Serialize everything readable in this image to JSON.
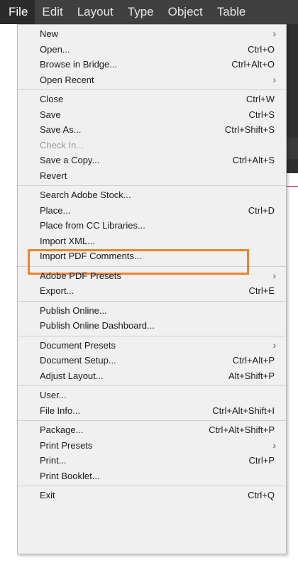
{
  "menubar": {
    "items": [
      "File",
      "Edit",
      "Layout",
      "Type",
      "Object",
      "Table"
    ]
  },
  "file_menu": {
    "groups": [
      [
        {
          "label": "New",
          "shortcut": "",
          "submenu": true,
          "disabled": false
        },
        {
          "label": "Open...",
          "shortcut": "Ctrl+O",
          "submenu": false,
          "disabled": false
        },
        {
          "label": "Browse in Bridge...",
          "shortcut": "Ctrl+Alt+O",
          "submenu": false,
          "disabled": false
        },
        {
          "label": "Open Recent",
          "shortcut": "",
          "submenu": true,
          "disabled": false
        }
      ],
      [
        {
          "label": "Close",
          "shortcut": "Ctrl+W",
          "submenu": false,
          "disabled": false
        },
        {
          "label": "Save",
          "shortcut": "Ctrl+S",
          "submenu": false,
          "disabled": false
        },
        {
          "label": "Save As...",
          "shortcut": "Ctrl+Shift+S",
          "submenu": false,
          "disabled": false
        },
        {
          "label": "Check In...",
          "shortcut": "",
          "submenu": false,
          "disabled": true
        },
        {
          "label": "Save a Copy...",
          "shortcut": "Ctrl+Alt+S",
          "submenu": false,
          "disabled": false
        },
        {
          "label": "Revert",
          "shortcut": "",
          "submenu": false,
          "disabled": false
        }
      ],
      [
        {
          "label": "Search Adobe Stock...",
          "shortcut": "",
          "submenu": false,
          "disabled": false
        },
        {
          "label": "Place...",
          "shortcut": "Ctrl+D",
          "submenu": false,
          "disabled": false,
          "highlighted": true
        },
        {
          "label": "Place from CC Libraries...",
          "shortcut": "",
          "submenu": false,
          "disabled": false
        },
        {
          "label": "Import XML...",
          "shortcut": "",
          "submenu": false,
          "disabled": false
        },
        {
          "label": "Import PDF Comments...",
          "shortcut": "",
          "submenu": false,
          "disabled": false
        }
      ],
      [
        {
          "label": "Adobe PDF Presets",
          "shortcut": "",
          "submenu": true,
          "disabled": false
        },
        {
          "label": "Export...",
          "shortcut": "Ctrl+E",
          "submenu": false,
          "disabled": false
        }
      ],
      [
        {
          "label": "Publish Online...",
          "shortcut": "",
          "submenu": false,
          "disabled": false
        },
        {
          "label": "Publish Online Dashboard...",
          "shortcut": "",
          "submenu": false,
          "disabled": false
        }
      ],
      [
        {
          "label": "Document Presets",
          "shortcut": "",
          "submenu": true,
          "disabled": false
        },
        {
          "label": "Document Setup...",
          "shortcut": "Ctrl+Alt+P",
          "submenu": false,
          "disabled": false
        },
        {
          "label": "Adjust Layout...",
          "shortcut": "Alt+Shift+P",
          "submenu": false,
          "disabled": false
        }
      ],
      [
        {
          "label": "User...",
          "shortcut": "",
          "submenu": false,
          "disabled": false
        },
        {
          "label": "File Info...",
          "shortcut": "Ctrl+Alt+Shift+I",
          "submenu": false,
          "disabled": false
        }
      ],
      [
        {
          "label": "Package...",
          "shortcut": "Ctrl+Alt+Shift+P",
          "submenu": false,
          "disabled": false
        },
        {
          "label": "Print Presets",
          "shortcut": "",
          "submenu": true,
          "disabled": false
        },
        {
          "label": "Print...",
          "shortcut": "Ctrl+P",
          "submenu": false,
          "disabled": false
        },
        {
          "label": "Print Booklet...",
          "shortcut": "",
          "submenu": false,
          "disabled": false
        }
      ],
      [
        {
          "label": "Exit",
          "shortcut": "Ctrl+Q",
          "submenu": false,
          "disabled": false
        }
      ]
    ],
    "submenu_arrow": "›"
  },
  "colors": {
    "menubar_bg": "#404040",
    "menu_bg": "#f0f0f0",
    "highlight_border": "#f0822d"
  }
}
